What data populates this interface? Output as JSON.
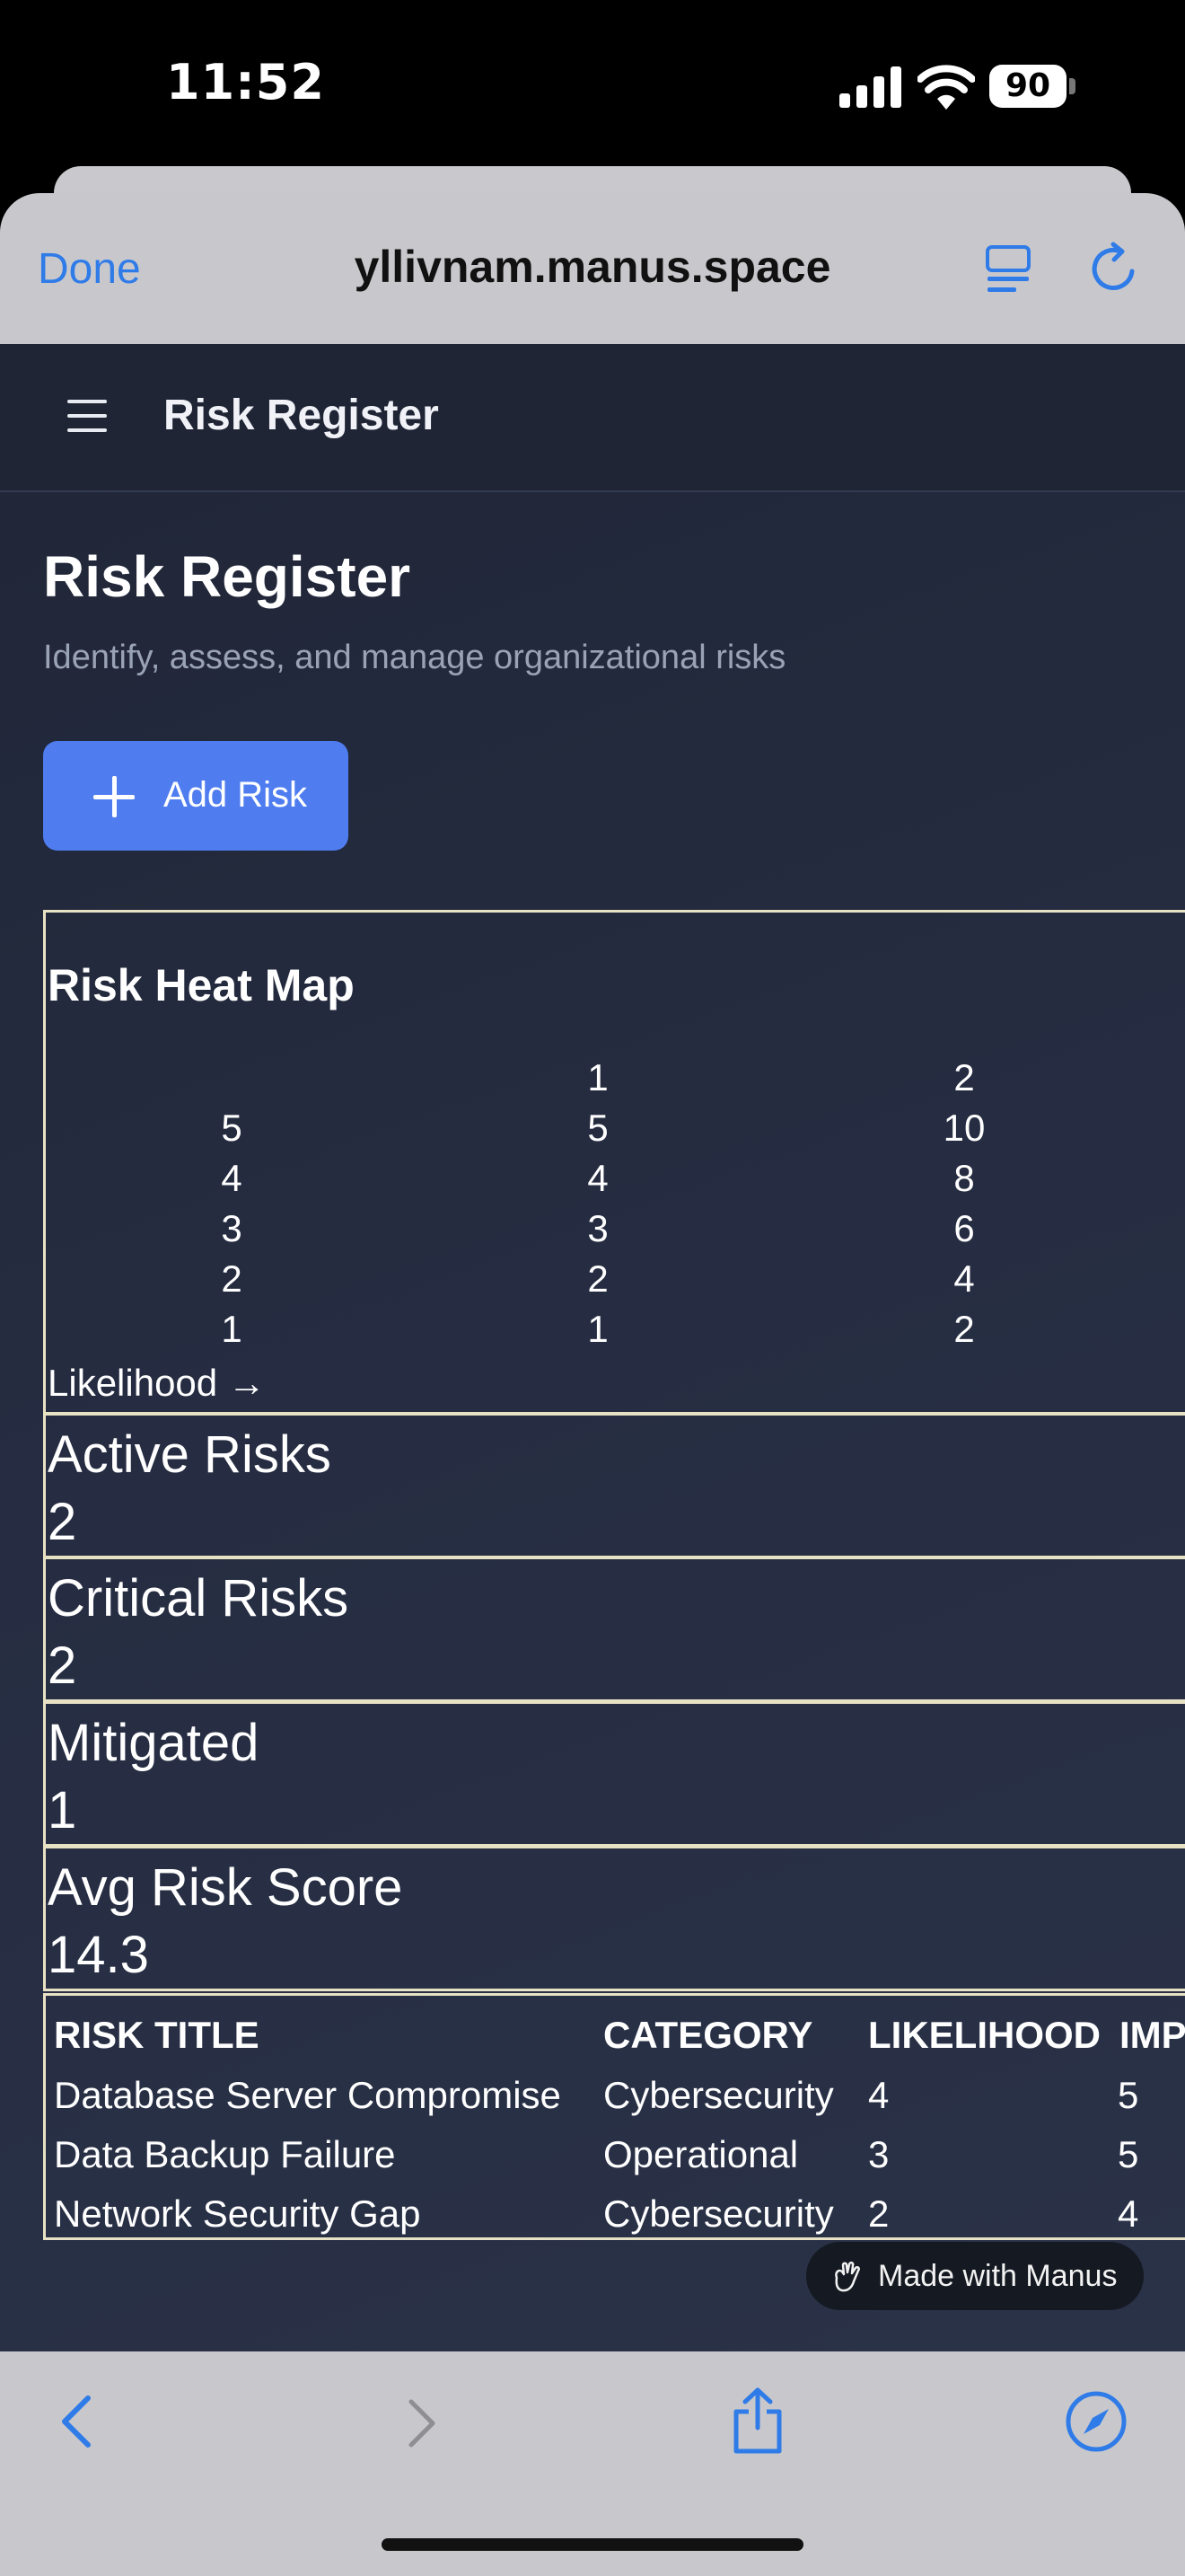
{
  "status_bar": {
    "time": "11:52",
    "battery": "90"
  },
  "browser": {
    "done_label": "Done",
    "url": "yllivnam.manus.space"
  },
  "app_nav": {
    "title": "Risk Register"
  },
  "page": {
    "title": "Risk Register",
    "subtitle": "Identify, assess, and manage organizational risks",
    "add_button": "Add Risk"
  },
  "heatmap": {
    "title": "Risk Heat Map",
    "impact_header": [
      "1",
      "2"
    ],
    "rows": [
      {
        "likelihood": "5",
        "cells": [
          "5",
          "10"
        ]
      },
      {
        "likelihood": "4",
        "cells": [
          "4",
          "8"
        ]
      },
      {
        "likelihood": "3",
        "cells": [
          "3",
          "6"
        ]
      },
      {
        "likelihood": "2",
        "cells": [
          "2",
          "4"
        ]
      },
      {
        "likelihood": "1",
        "cells": [
          "1",
          "2"
        ]
      }
    ],
    "axis_label": "Likelihood →"
  },
  "stats": [
    {
      "label": "Active Risks",
      "value": "2"
    },
    {
      "label": "Critical Risks",
      "value": "2"
    },
    {
      "label": "Mitigated",
      "value": "1"
    },
    {
      "label": "Avg Risk Score",
      "value": "14.3"
    }
  ],
  "table": {
    "headers": [
      "RISK TITLE",
      "CATEGORY",
      "LIKELIHOOD",
      "IMP"
    ],
    "rows": [
      [
        "Database Server Compromise",
        "Cybersecurity",
        "4",
        "5"
      ],
      [
        "Data Backup Failure",
        "Operational",
        "3",
        "5"
      ],
      [
        "Network Security Gap",
        "Cybersecurity",
        "2",
        "4"
      ]
    ]
  },
  "badge": {
    "text": "Made with Manus"
  },
  "colors": {
    "accent": "#4f7df0",
    "link": "#2f7be8",
    "border": "#e8e2c4",
    "background": "#262d42"
  }
}
